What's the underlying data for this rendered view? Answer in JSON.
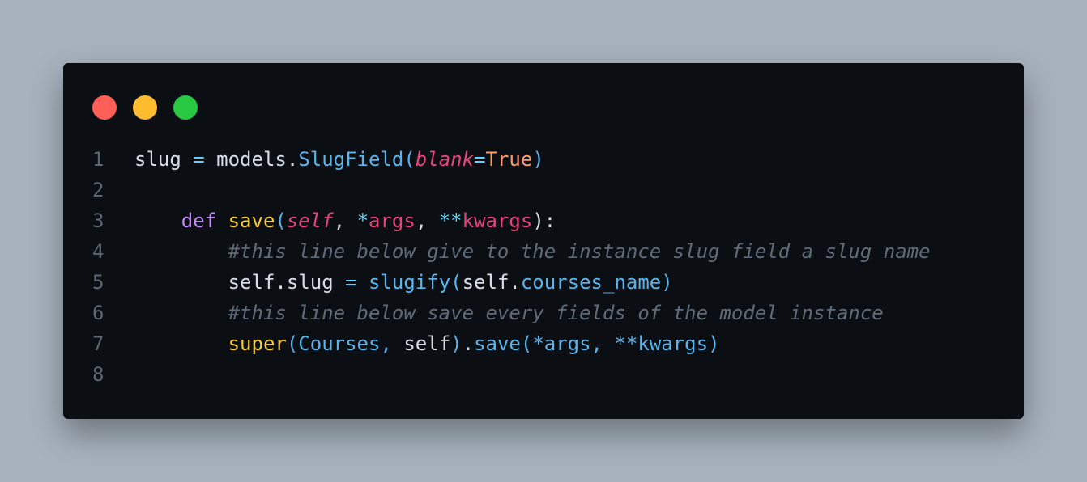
{
  "window": {
    "dots": [
      {
        "name": "close",
        "color": "#ff5f57"
      },
      {
        "name": "minimize",
        "color": "#febc2e"
      },
      {
        "name": "maximize",
        "color": "#28c840"
      }
    ]
  },
  "code": {
    "lines": [
      {
        "number": "1",
        "indent": "",
        "tokens": [
          {
            "text": "slug",
            "kind": "var"
          },
          {
            "text": " = ",
            "kind": "op"
          },
          {
            "text": "models",
            "kind": "var"
          },
          {
            "text": ".",
            "kind": "var"
          },
          {
            "text": "SlugField",
            "kind": "class"
          },
          {
            "text": "(",
            "kind": "paren"
          },
          {
            "text": "blank",
            "kind": "param"
          },
          {
            "text": "=",
            "kind": "op"
          },
          {
            "text": "True",
            "kind": "const"
          },
          {
            "text": ")",
            "kind": "paren"
          }
        ]
      },
      {
        "number": "2",
        "indent": "",
        "tokens": []
      },
      {
        "number": "3",
        "indent": "    ",
        "tokens": [
          {
            "text": "def",
            "kind": "keyword"
          },
          {
            "text": " ",
            "kind": "default"
          },
          {
            "text": "save",
            "kind": "func"
          },
          {
            "text": "(",
            "kind": "paren"
          },
          {
            "text": "self",
            "kind": "param"
          },
          {
            "text": ", ",
            "kind": "default"
          },
          {
            "text": "*",
            "kind": "op"
          },
          {
            "text": "args",
            "kind": "kw"
          },
          {
            "text": ", ",
            "kind": "default"
          },
          {
            "text": "**",
            "kind": "op"
          },
          {
            "text": "kwargs",
            "kind": "kw"
          },
          {
            "text": "):",
            "kind": "default"
          }
        ]
      },
      {
        "number": "4",
        "indent": "        ",
        "tokens": [
          {
            "text": "#this line below give to the instance slug field a slug name",
            "kind": "comment"
          }
        ]
      },
      {
        "number": "5",
        "indent": "        ",
        "tokens": [
          {
            "text": "self",
            "kind": "var"
          },
          {
            "text": ".",
            "kind": "var"
          },
          {
            "text": "slug",
            "kind": "var"
          },
          {
            "text": " = ",
            "kind": "op"
          },
          {
            "text": "slugify",
            "kind": "class"
          },
          {
            "text": "(",
            "kind": "paren"
          },
          {
            "text": "self",
            "kind": "var"
          },
          {
            "text": ".",
            "kind": "var"
          },
          {
            "text": "courses_name",
            "kind": "attr"
          },
          {
            "text": ")",
            "kind": "paren"
          }
        ]
      },
      {
        "number": "6",
        "indent": "        ",
        "tokens": [
          {
            "text": "#this line below save every fields of the model instance",
            "kind": "comment"
          }
        ]
      },
      {
        "number": "7",
        "indent": "        ",
        "tokens": [
          {
            "text": "super",
            "kind": "func"
          },
          {
            "text": "(",
            "kind": "paren"
          },
          {
            "text": "Courses",
            "kind": "class"
          },
          {
            "text": ", ",
            "kind": "class"
          },
          {
            "text": "self",
            "kind": "var"
          },
          {
            "text": ")",
            "kind": "paren"
          },
          {
            "text": ".",
            "kind": "var"
          },
          {
            "text": "save",
            "kind": "class"
          },
          {
            "text": "(",
            "kind": "paren"
          },
          {
            "text": "*args, **kwargs",
            "kind": "attr"
          },
          {
            "text": ")",
            "kind": "paren"
          }
        ]
      },
      {
        "number": "8",
        "indent": "",
        "tokens": []
      }
    ]
  }
}
